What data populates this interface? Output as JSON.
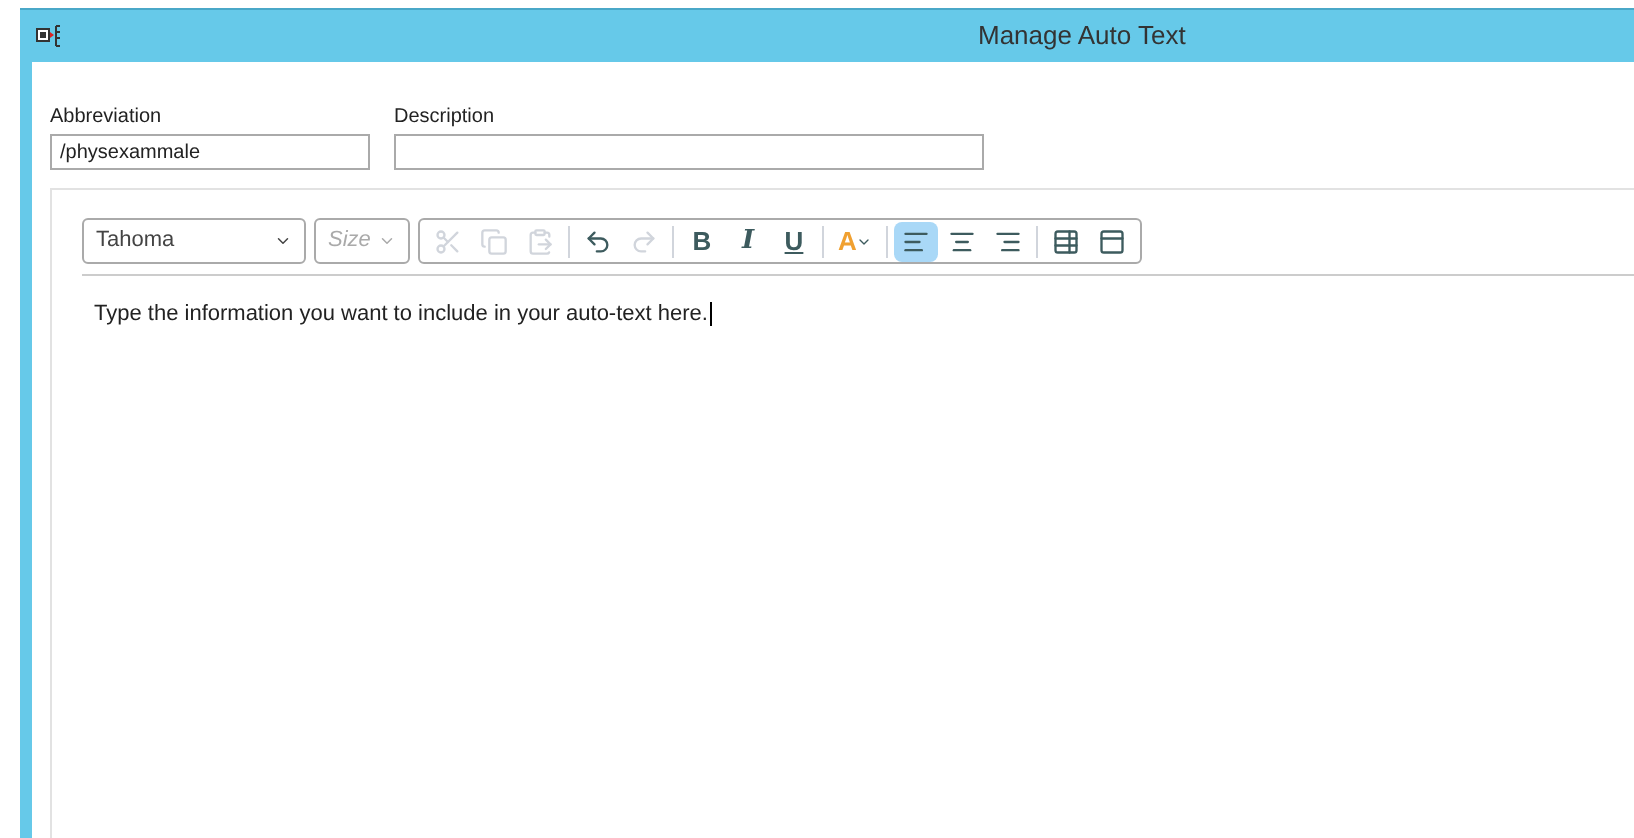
{
  "window": {
    "title": "Manage Auto Text"
  },
  "fields": [
    {
      "label": "Abbreviation",
      "value": "/physexammale",
      "kind": "short"
    },
    {
      "label": "Description",
      "kind": "long"
    }
  ],
  "editor": {
    "font": {
      "value": "Tahoma"
    },
    "size": {
      "placeholder": "Size"
    },
    "tools": [
      {
        "kind": "cut",
        "disabled": true,
        "selected": false
      },
      {
        "kind": "copy",
        "disabled": true,
        "selected": false
      },
      {
        "kind": "paste",
        "disabled": true,
        "selected": false
      },
      {
        "kind": "sep"
      },
      {
        "kind": "undo",
        "disabled": false,
        "selected": false
      },
      {
        "kind": "redo",
        "disabled": true,
        "selected": false
      },
      {
        "kind": "sep"
      },
      {
        "kind": "bold",
        "disabled": false,
        "selected": false,
        "text": "B"
      },
      {
        "kind": "italic",
        "disabled": false,
        "selected": false,
        "text": "I"
      },
      {
        "kind": "underline",
        "disabled": false,
        "selected": false,
        "text": "U"
      },
      {
        "kind": "sep"
      },
      {
        "kind": "color",
        "disabled": false,
        "selected": false,
        "text": "A"
      },
      {
        "kind": "sep"
      },
      {
        "kind": "align-left",
        "disabled": false,
        "selected": true
      },
      {
        "kind": "align-center",
        "disabled": false,
        "selected": false
      },
      {
        "kind": "align-right",
        "disabled": false,
        "selected": false
      },
      {
        "kind": "sep"
      },
      {
        "kind": "insert",
        "disabled": false,
        "selected": false
      },
      {
        "kind": "template",
        "disabled": false,
        "selected": false
      }
    ],
    "content": "Type the information you want to include in your auto-text here."
  }
}
